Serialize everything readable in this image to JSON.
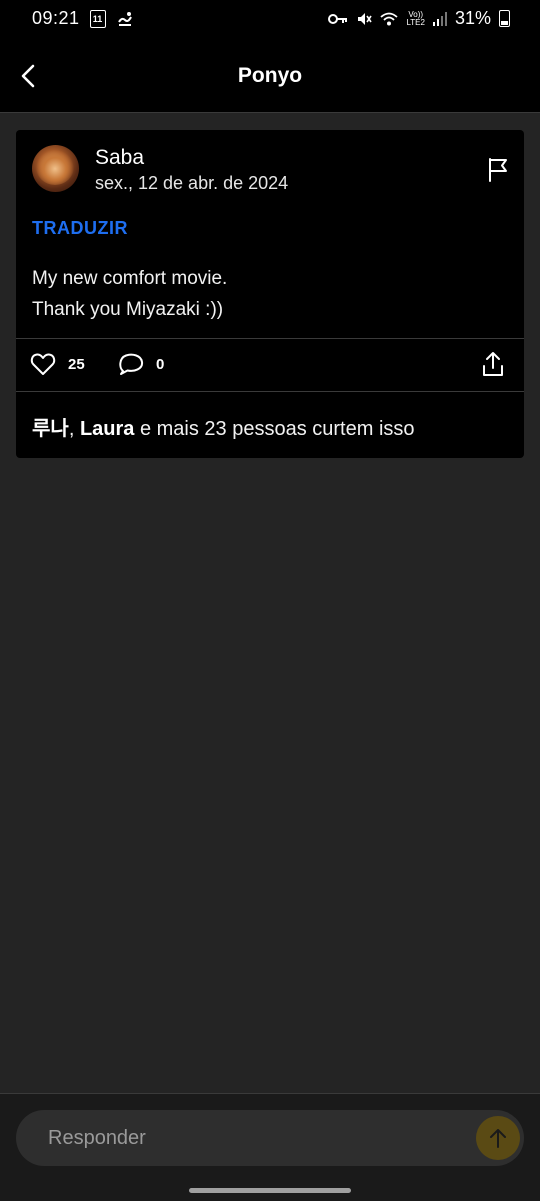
{
  "status_bar": {
    "time": "09:21",
    "calendar_day": "11",
    "volte_label": "Vo))",
    "lte_label": "LTE2",
    "battery": "31%"
  },
  "header": {
    "title": "Ponyo"
  },
  "post": {
    "author": "Saba",
    "date": "sex., 12 de abr. de 2024",
    "translate_label": "TRADUZIR",
    "text_line1": "My new comfort movie.",
    "text_line2": "Thank you Miyazaki :))",
    "like_count": "25",
    "comment_count": "0",
    "likers_name1": "루나",
    "likers_sep": ", ",
    "likers_name2": "Laura",
    "likers_rest": " e mais 23 pessoas curtem isso"
  },
  "reply": {
    "placeholder": "Responder"
  },
  "colors": {
    "accent_blue": "#1e6ef0",
    "background": "#242424",
    "card": "#000000"
  }
}
